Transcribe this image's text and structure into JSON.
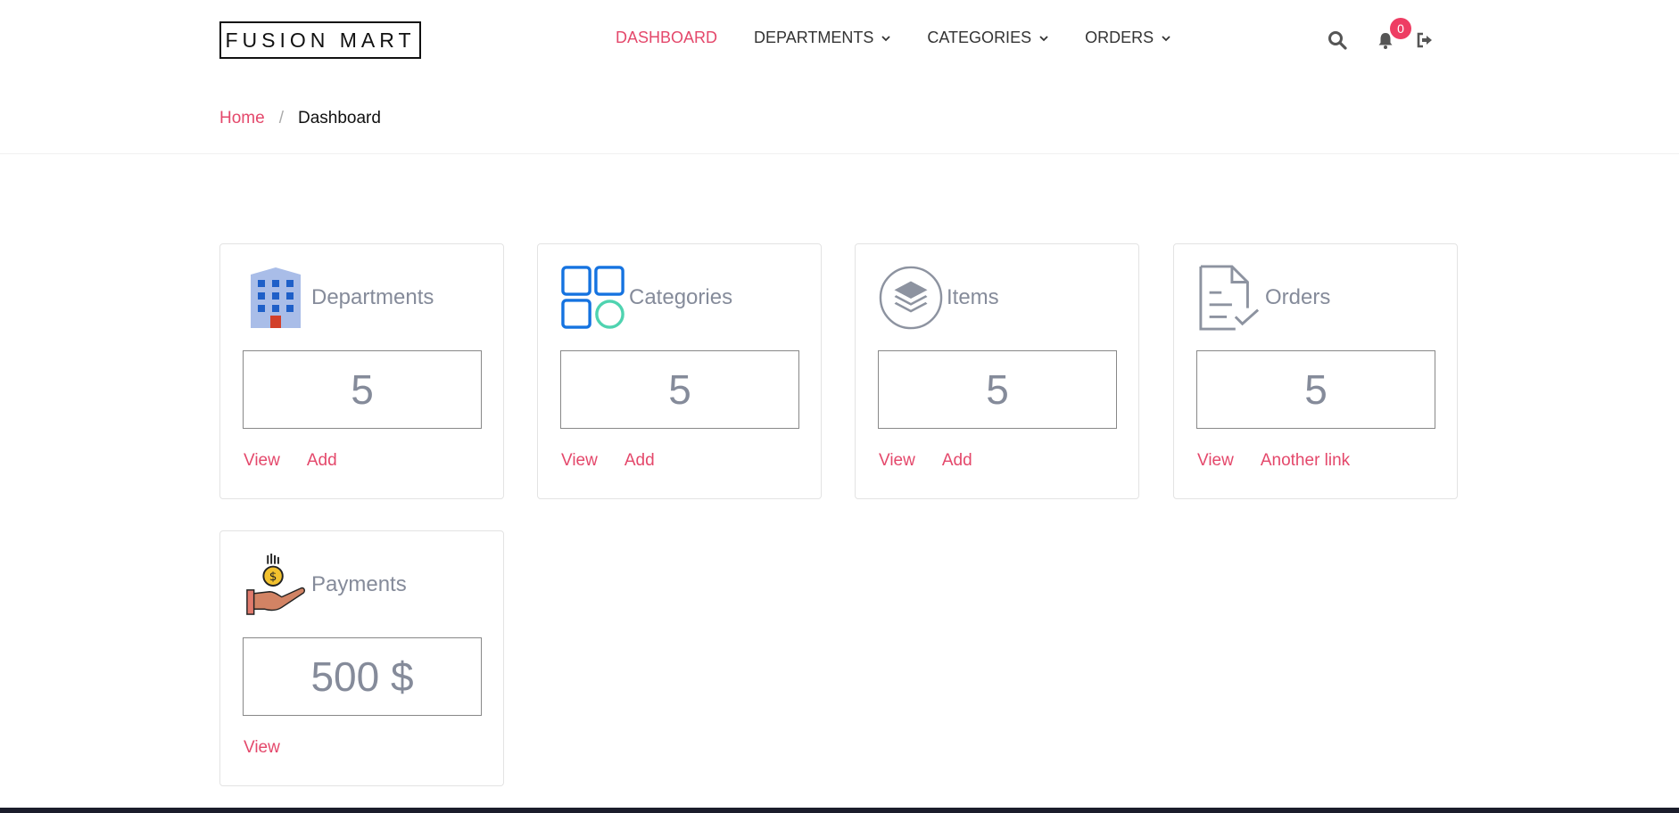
{
  "brand": "FUSION MART",
  "nav": [
    {
      "label": "DASHBOARD",
      "active": true,
      "dropdown": false
    },
    {
      "label": "DEPARTMENTS",
      "active": false,
      "dropdown": true
    },
    {
      "label": "CATEGORIES",
      "active": false,
      "dropdown": true
    },
    {
      "label": "ORDERS",
      "active": false,
      "dropdown": true
    }
  ],
  "header": {
    "icons": [
      "search-icon",
      "bell-icon",
      "sign-out-icon"
    ],
    "notification_count": "0"
  },
  "breadcrumb": {
    "home": "Home",
    "separator": "/",
    "current": "Dashboard"
  },
  "cards": [
    {
      "title": "Departments",
      "value": "5",
      "links": [
        "View",
        "Add"
      ],
      "icon": "building-icon"
    },
    {
      "title": "Categories",
      "value": "5",
      "links": [
        "View",
        "Add"
      ],
      "icon": "grid-icon"
    },
    {
      "title": "Items",
      "value": "5",
      "links": [
        "View",
        "Add"
      ],
      "icon": "layers-icon"
    },
    {
      "title": "Orders",
      "value": "5",
      "links": [
        "View",
        "Another link"
      ],
      "icon": "document-check-icon"
    },
    {
      "title": "Payments",
      "value": "500 $",
      "links": [
        "View"
      ],
      "icon": "hand-coin-icon"
    }
  ],
  "colors": {
    "accent": "#e4486b",
    "badge": "#ee3d63",
    "muted": "#858b9a"
  }
}
